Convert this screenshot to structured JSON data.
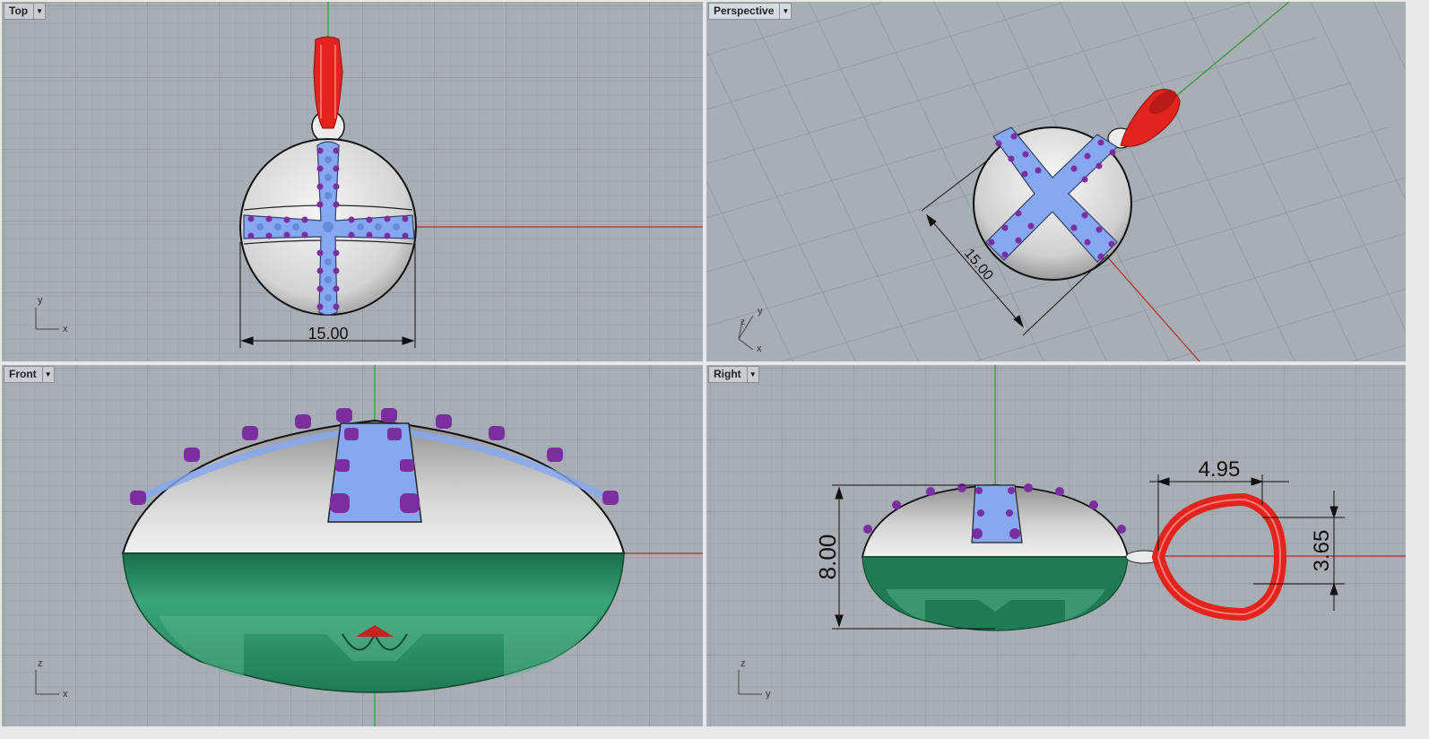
{
  "viewports": {
    "top": {
      "label": "Top",
      "dimension": "15.00",
      "axis_v": "y",
      "axis_h": "x"
    },
    "persp": {
      "label": "Perspective",
      "dimension": "15.00",
      "axis_z": "z",
      "axis_v": "y",
      "axis_h": "x"
    },
    "front": {
      "label": "Front",
      "axis_v": "z",
      "axis_h": "x"
    },
    "right": {
      "label": "Right",
      "dim_height": "8.00",
      "dim_bail_width": "4.95",
      "dim_bail_height": "3.65",
      "axis_v": "z",
      "axis_h": "y"
    }
  },
  "colors": {
    "viewport_bg": "#a9aeb4",
    "grid_minor": "#9da2a8",
    "grid_major": "#8a8f95",
    "x_axis": "#b0302a",
    "y_axis": "#2f9a3a",
    "silver": "#d9d9d9",
    "green": "#1f7a55",
    "cross_blue": "#86a8f0",
    "prong_purple": "#7a2ea0",
    "bail_red": "#e3231d"
  },
  "icons": {
    "dropdown": "chevron-down-icon",
    "axis_widget": "axis-triad-icon"
  }
}
